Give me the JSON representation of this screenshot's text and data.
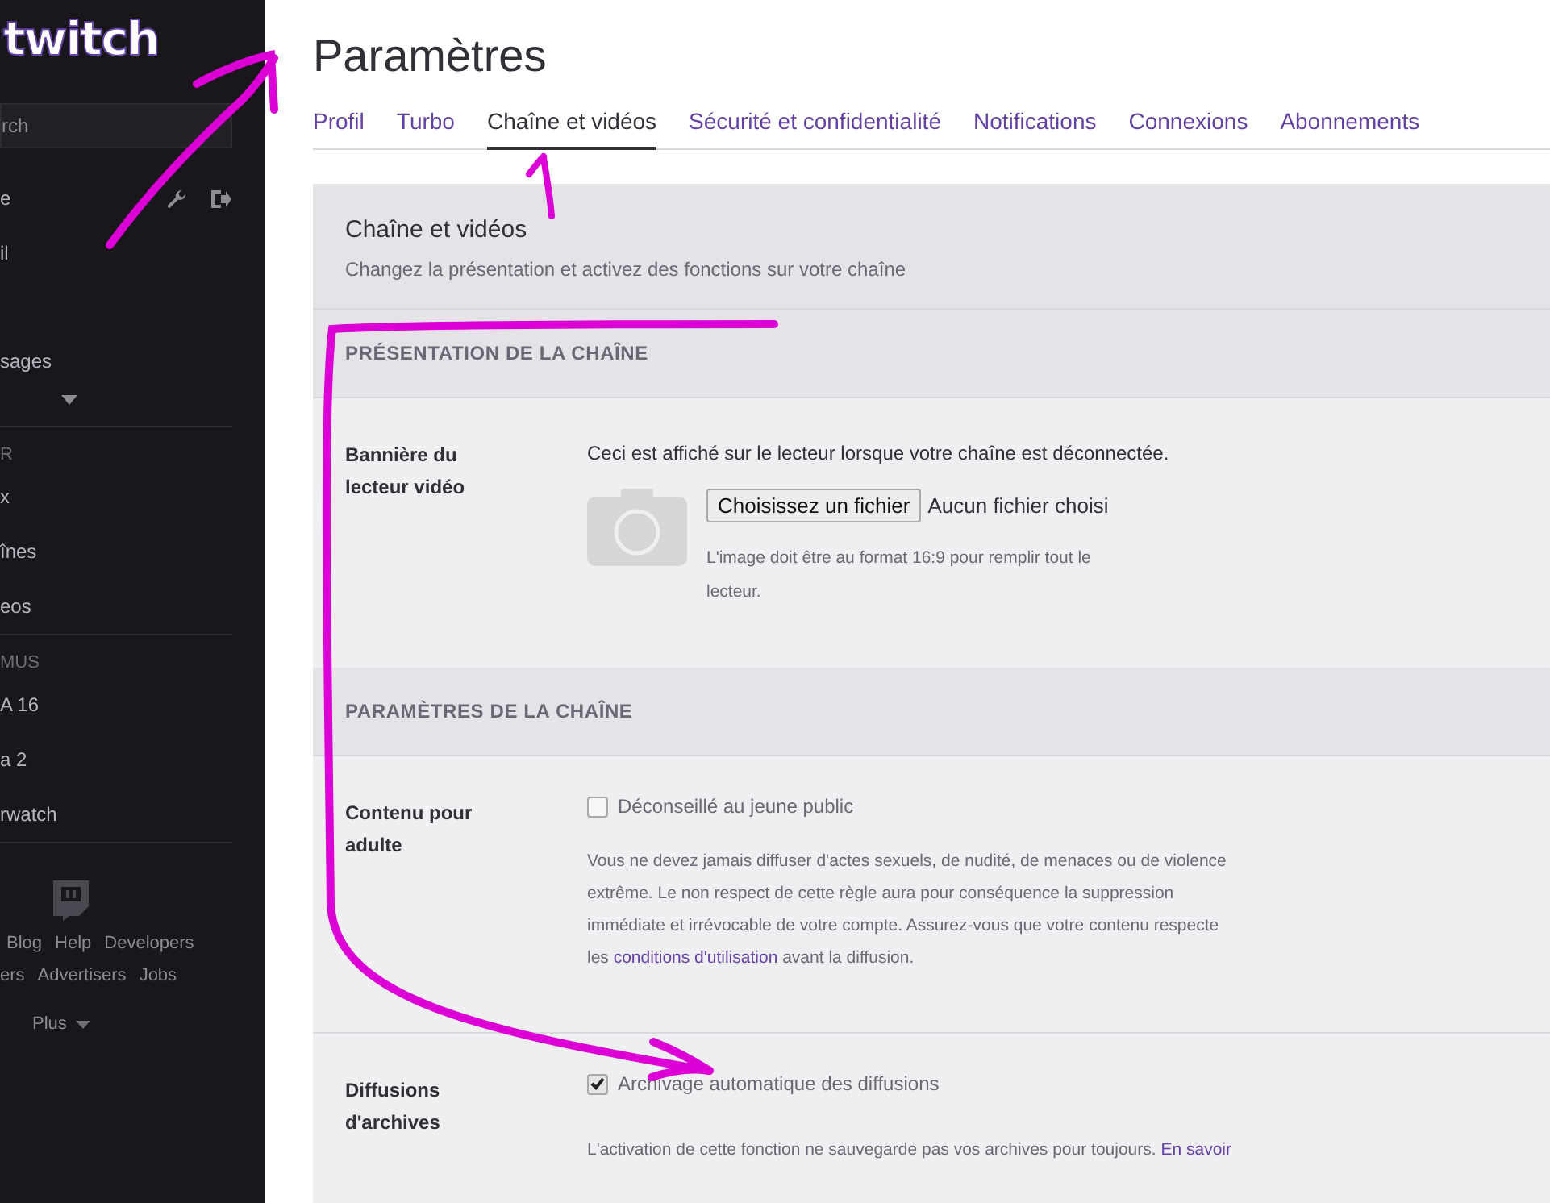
{
  "sidebar": {
    "logo": "twitch",
    "search": {
      "placeholder": "rch"
    },
    "user_items": [
      {
        "label": "e",
        "has_tools": true
      },
      {
        "label": "il",
        "has_tools": false
      },
      {
        "label": "sages",
        "has_tools": false
      }
    ],
    "section_1": {
      "heading": "R",
      "items": [
        "x",
        "înes",
        "eos"
      ]
    },
    "section_2": {
      "heading": "MUS",
      "items": [
        "A 16",
        "a 2",
        "rwatch"
      ]
    },
    "footer_links": [
      [
        "Blog",
        "Help",
        "Developers"
      ],
      [
        "ers",
        "Advertisers",
        "Jobs"
      ]
    ],
    "more": "Plus"
  },
  "page": {
    "title": "Paramètres",
    "tabs": [
      {
        "label": "Profil",
        "selected": false
      },
      {
        "label": "Turbo",
        "selected": false
      },
      {
        "label": "Chaîne et vidéos",
        "selected": true
      },
      {
        "label": "Sécurité et confidentialité",
        "selected": false
      },
      {
        "label": "Notifications",
        "selected": false
      },
      {
        "label": "Connexions",
        "selected": false
      },
      {
        "label": "Abonnements",
        "selected": false
      }
    ],
    "panel": {
      "title": "Chaîne et vidéos",
      "subtitle": "Changez la présentation et activez des fonctions sur votre chaîne"
    },
    "sections": [
      {
        "heading": "PRÉSENTATION DE LA CHAÎNE",
        "rows": [
          {
            "kind": "upload",
            "label": "Bannière du lecteur vidéo",
            "description": "Ceci est affiché sur le lecteur lorsque votre chaîne est déconnectée.",
            "button": "Choisissez un fichier",
            "file_status": "Aucun fichier choisi",
            "hint": "L'image doit être au format 16:9 pour remplir tout le lecteur."
          }
        ]
      },
      {
        "heading": "PARAMÈTRES DE LA CHAÎNE",
        "rows": [
          {
            "kind": "checkbox",
            "label": "Contenu pour adulte",
            "option": "Déconseillé au jeune public",
            "checked": false,
            "note_before": "Vous ne devez jamais diffuser d'actes sexuels, de nudité, de menaces ou de violence extrême. Le non respect de cette règle aura pour conséquence la suppression immédiate et irrévocable de votre compte. Assurez-vous que votre contenu respecte les",
            "note_link": "conditions d'utilisation",
            "note_after": "avant la diffusion."
          },
          {
            "kind": "checkbox",
            "label": "Diffusions d'archives",
            "option": "Archivage automatique des diffusions",
            "checked": true,
            "note_before": "L'activation de cette fonction ne sauvegarde pas vos archives pour toujours.",
            "note_link": "En savoir",
            "note_after": ""
          }
        ]
      }
    ]
  }
}
